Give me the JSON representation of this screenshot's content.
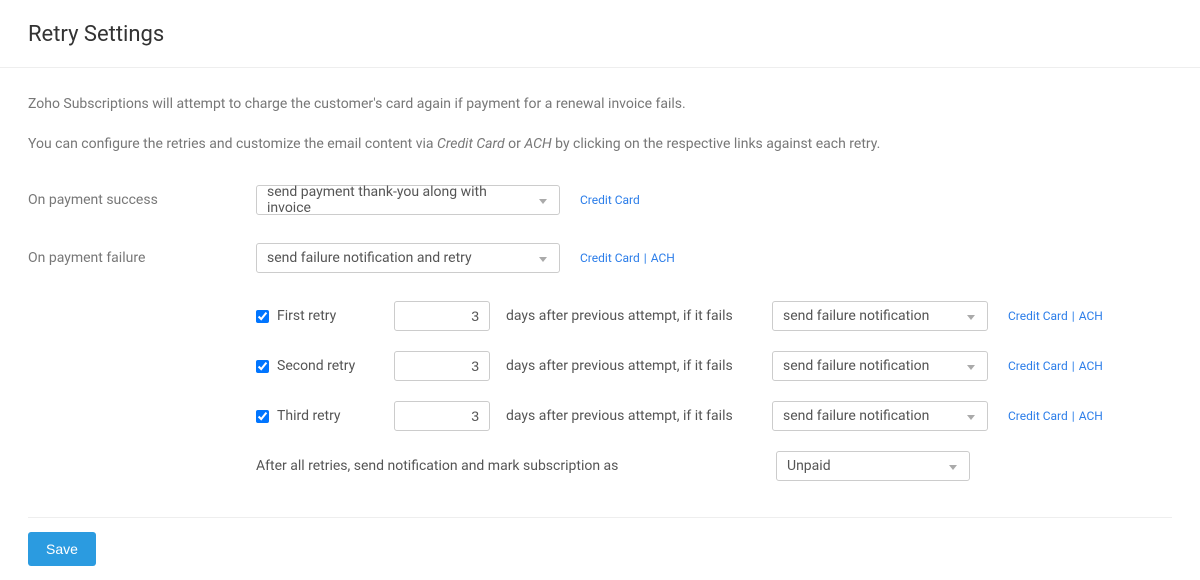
{
  "title": "Retry Settings",
  "intro1_prefix": "Zoho Subscriptions will ",
  "intro1_rest": "attempt to charge the customer's card again if payment for a renewal invoice fails.",
  "intro2_prefix": "You can configure the retries and customize the email content via ",
  "intro2_cc": "Credit Card",
  "intro2_or": " or ",
  "intro2_ach": "ACH",
  "intro2_suffix": " by clicking on the respective links against each retry.",
  "on_success": {
    "label": "On payment success",
    "select_value": "send payment thank-you along with invoice",
    "link_cc": "Credit Card"
  },
  "on_failure": {
    "label": "On payment failure",
    "select_value": "send failure notification and retry",
    "link_cc": "Credit Card",
    "link_sep": " | ",
    "link_ach": "ACH"
  },
  "retries": [
    {
      "label": "First retry",
      "days": "3",
      "after_text": "days after previous attempt, if it fails",
      "action_value": "send failure notification",
      "link_cc": "Credit Card",
      "link_sep": " | ",
      "link_ach": "ACH"
    },
    {
      "label": "Second retry",
      "days": "3",
      "after_text": "days after previous attempt, if it fails",
      "action_value": "send failure notification",
      "link_cc": "Credit Card",
      "link_sep": " | ",
      "link_ach": "ACH"
    },
    {
      "label": "Third retry",
      "days": "3",
      "after_text": "days after previous attempt, if it fails",
      "action_value": "send failure notification",
      "link_cc": "Credit Card",
      "link_sep": " | ",
      "link_ach": "ACH"
    }
  ],
  "after_all": {
    "label": "After all retries, send notification and mark subscription as",
    "select_value": "Unpaid"
  },
  "save_label": "Save"
}
